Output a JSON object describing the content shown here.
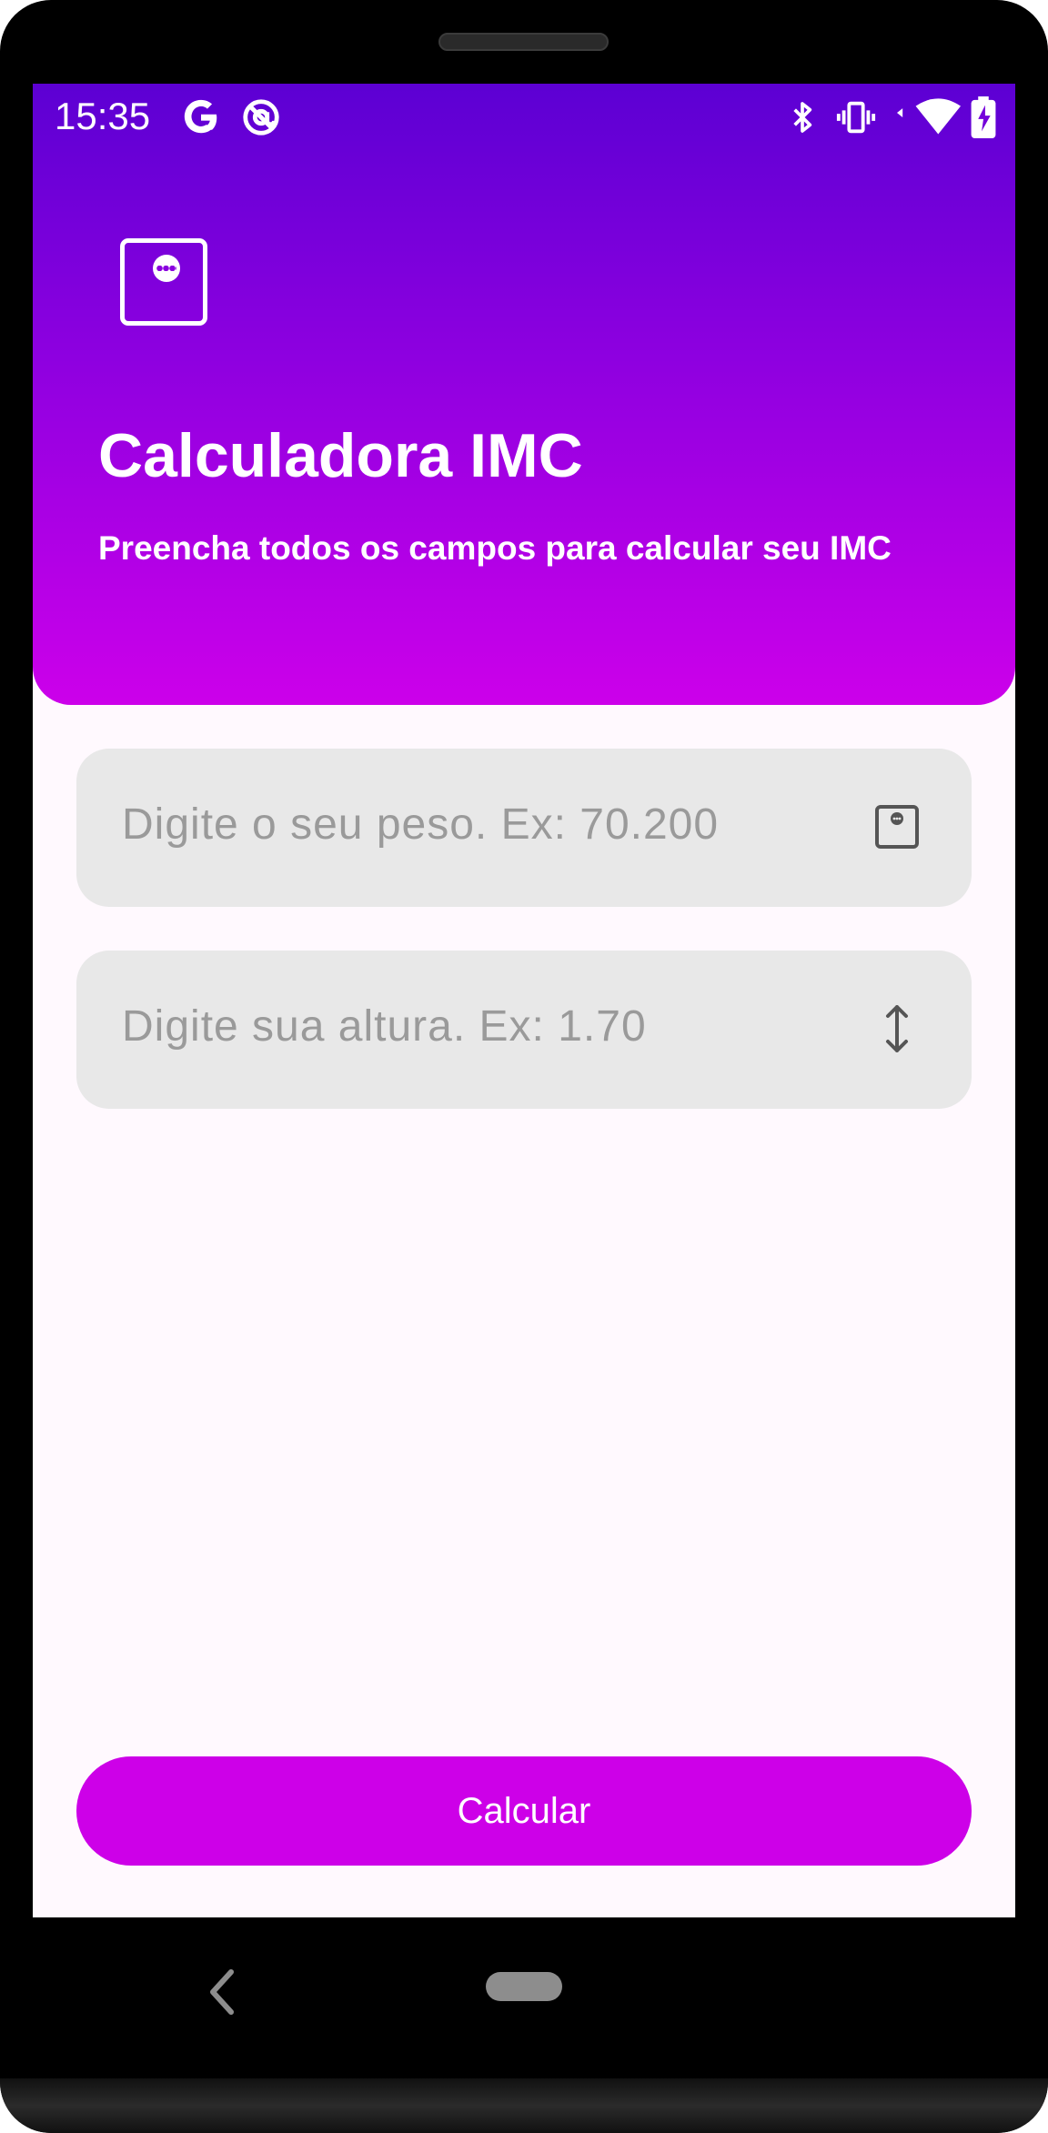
{
  "status_bar": {
    "time": "15:35",
    "icons": [
      "google-icon",
      "at-sign-icon",
      "bluetooth-icon",
      "vibrate-icon",
      "wifi-icon",
      "battery-charging-icon"
    ]
  },
  "header": {
    "icon": "calculator-icon",
    "title": "Calculadora IMC",
    "subtitle": "Preencha todos os campos para calcular seu IMC"
  },
  "form": {
    "weight_placeholder": "Digite o seu peso. Ex: 70.200",
    "weight_icon": "scale-icon",
    "height_placeholder": "Digite sua altura. Ex: 1.70",
    "height_icon": "height-arrows-icon"
  },
  "actions": {
    "calculate_label": "Calcular"
  },
  "navigation": {
    "buttons": [
      "back-icon",
      "home-pill"
    ]
  },
  "colors": {
    "header_top": "#5c00d3",
    "header_bottom": "#cc00ea",
    "button": "#cd00e8",
    "field_bg": "#e8e8e8",
    "placeholder": "#9a9a9a"
  }
}
